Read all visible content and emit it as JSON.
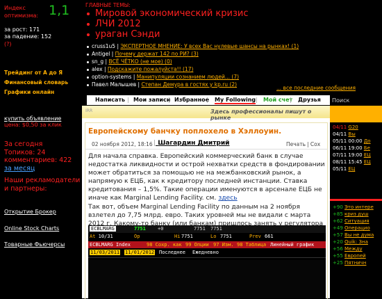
{
  "left": {
    "optimism_label": "Индекс\nоптимизма:",
    "optimism_value": "1,1",
    "growth_label": "за рост:",
    "growth_value": "171",
    "fall_label": "за падение:",
    "fall_value": "152",
    "question": "(?)",
    "links": [
      "Трейдинг от А до Я",
      "Финансовый словарь",
      "Графики онлайн"
    ],
    "buy_ad": "купить объявление",
    "price": "цена: $0,50 за клик",
    "today": "За сегодня",
    "topics": "Топиков: 24",
    "comments": "комментариев: 422",
    "month": "за месяц",
    "advertisers": "Наши рекламодатели и партнеры:",
    "partners": [
      "Открытие Брокер",
      "Online Stock Charts",
      "Товарные Фьючерсы"
    ]
  },
  "header": {
    "main_topics_label": "ГЛАВНЫЕ ТЕМЫ:",
    "topics": [
      "Мировой экономический кризис",
      "ЛЧИ 2012",
      "ураган Сэнди"
    ],
    "feed": [
      {
        "user": "cruss1u5",
        "text": "ЭКСПЕРТНОЕ МНЕНИЕ: У всех Вас нулевые шансы на рынках! (1)"
      },
      {
        "user": "Antigel",
        "text": "Почему держат 142 по РИ? (3)"
      },
      {
        "user": "sn_g",
        "text": "ВСЁ ЧЁТКО (не мое) (0)"
      },
      {
        "user": "alex",
        "text": "Подскажите пожалуйста!! (17)"
      },
      {
        "user": "option-systems",
        "text": "Манипуляции сознанием людей... (7)"
      },
      {
        "user": "Павел Малышев",
        "text": "Степан Демура в гостях у kp.ru (2)"
      }
    ],
    "all_messages": "... все последние сообщения"
  },
  "nav": {
    "items": [
      "Написать",
      "Мои записи",
      "Избранное",
      "My Following",
      "Мой счет",
      "Друзья"
    ],
    "search": "Поиск"
  },
  "banner": {
    "left": "IRR",
    "text": "Здесь профессионалы пишут о рынке"
  },
  "article": {
    "title": "Европейскому банчку поплохело в Хэллоуин.",
    "date": "02 ноября 2012, 18:16",
    "author": "Шагардин Дмитрий",
    "print": "Печать",
    "save": "Сох",
    "p1": "Для начала справка. Европейский коммерческий банк в случае недостатка ликвидности и острой нехватки средств в фондировании может обратиться за помощью не на межбанковский рынок, а напрямую к ЕЦБ, как к кредитору последней инстанции. Ставка кредитования – 1,5%. Такие операции именуются в арсенале ЕЦБ не иначе как  Marginal Lending Facility. см.",
    "p1_link": "здесь",
    "p2": "Так вот, объем  Marginal Lending Facility по данным на 2 ноября взлетел до 7,75 млрд. евро. Таких уровней мы не видали с марта 2012 г. Какому-то банку (или банкам) пришлось занять у регулятора порядка 7 млрд. евро. не хило так."
  },
  "terminal": {
    "ticker": "ECBLMARG",
    "value": "7751",
    "chg": "+0",
    "fld1": "7751",
    "fld2": "7751",
    "at_label": "At",
    "at_value": "10/31",
    "op_label": "Op",
    "hi_label": "Hi",
    "lo_label": "Lo",
    "prev_label": "Prev",
    "prev_value": "661",
    "index_label": "ECBLMARG  Index",
    "menu": [
      "98 Сохр. как",
      "99 Опции",
      "97 Изм.",
      "98 Таблица",
      "Линейный график"
    ],
    "date1": "11/03/2011",
    "date2": "11/01/2012",
    "period": "Последнее",
    "freq": "Ежедневно"
  },
  "right": {
    "rows": [
      {
        "a": "04/11",
        "b": "G20"
      },
      {
        "a": "04/11",
        "b": "Вы"
      },
      {
        "a": "05/11 00:00",
        "b": "До"
      },
      {
        "a": "06/11 19:00",
        "b": "Бе"
      },
      {
        "a": "07/11 19:00",
        "b": "ЕЦ"
      },
      {
        "a": "08/11 15:45",
        "b": "ЕЦ"
      },
      {
        "a": "05/11",
        "b": "ЕЦ"
      }
    ],
    "news": [
      {
        "n": "+90",
        "t": "Это интере"
      },
      {
        "n": "+85",
        "t": "криз душ"
      },
      {
        "n": "+62",
        "t": "Ситуация"
      },
      {
        "n": "+49",
        "t": "Операцио"
      },
      {
        "n": "+57",
        "t": "Вы не дума"
      },
      {
        "n": "+20",
        "t": "Quik: Зна"
      },
      {
        "n": "+56",
        "t": "Между"
      },
      {
        "n": "+55",
        "t": "Европей"
      },
      {
        "n": "+25",
        "t": "Пятничн"
      }
    ]
  },
  "colors": {
    "accent_red": "#ff2020",
    "accent_orange": "#ffb000",
    "green": "#20c020"
  }
}
